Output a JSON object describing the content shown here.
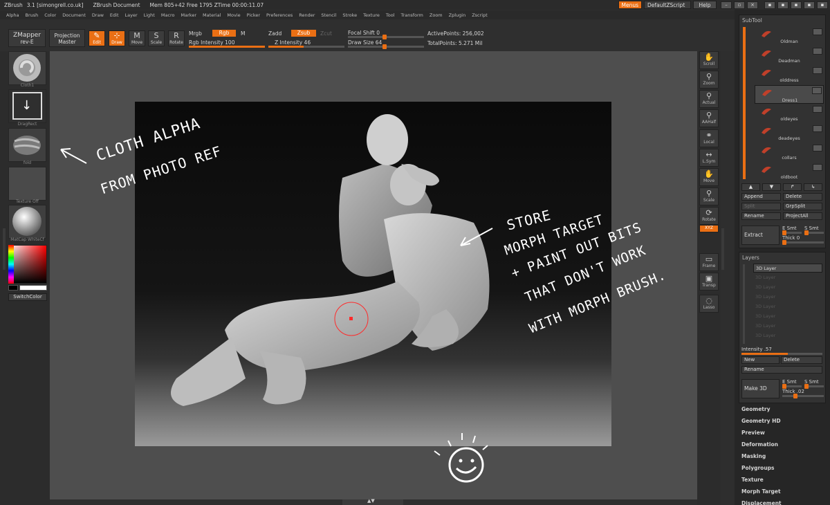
{
  "window": {
    "title_parts": [
      "ZBrush",
      "3.1 [simongrell.co.uk]",
      "ZBrush Document",
      "Mem 805+42 Free 1795 ZTime 00:00:11.07"
    ],
    "buttons": {
      "menus": "Menus",
      "script": "DefaultZScript",
      "help": "Help"
    }
  },
  "menubar": [
    "Alpha",
    "Brush",
    "Color",
    "Document",
    "Draw",
    "Edit",
    "Layer",
    "Light",
    "Macro",
    "Marker",
    "Material",
    "Movie",
    "Picker",
    "Preferences",
    "Render",
    "Stencil",
    "Stroke",
    "Texture",
    "Tool",
    "Transform",
    "Zoom",
    "Zplugin",
    "Zscript"
  ],
  "toolbar": {
    "zmapper_line1": "ZMapper",
    "zmapper_line2": "rev-E",
    "projection_line1": "Projection",
    "projection_line2": "Master",
    "tools": [
      {
        "label": "Edit",
        "glyph": "✎",
        "active": true
      },
      {
        "label": "Draw",
        "glyph": "⊹",
        "active": true
      },
      {
        "label": "Move",
        "glyph": "M",
        "active": false
      },
      {
        "label": "Scale",
        "glyph": "S",
        "active": false
      },
      {
        "label": "Rotate",
        "glyph": "R",
        "active": false
      }
    ],
    "mrgb": "Mrgb",
    "rgb": "Rgb",
    "m": "M",
    "rgb_intensity": "Rgb Intensity 100",
    "rgb_intensity_value": 100,
    "zadd": "Zadd",
    "zsub": "Zsub",
    "zcut": "Zcut",
    "z_intensity": "Z Intensity 46",
    "z_intensity_value": 46,
    "focal_shift": "Focal Shift 0",
    "focal_shift_value": 0,
    "draw_size": "Draw Size 64",
    "draw_size_value": 64,
    "active_points": "ActivePoints: 256,002",
    "total_points": "TotalPoints: 5.271 Mil"
  },
  "left_panel": {
    "thumbs": [
      {
        "caption": "Cloth1",
        "kind": "alpha-swirl"
      },
      {
        "caption": "DragRect",
        "kind": "stroke"
      },
      {
        "caption": "fold",
        "kind": "alpha-fold"
      },
      {
        "caption": "Texture Off",
        "kind": "texture"
      },
      {
        "caption": "MatCap WhiteCf",
        "kind": "material"
      }
    ],
    "switch_color": "SwitchColor"
  },
  "right_strip": [
    {
      "label": "Scroll",
      "icon": "hand-icon",
      "glyph": "✋"
    },
    {
      "label": "Zoom",
      "icon": "zoom-icon",
      "glyph": "⚲"
    },
    {
      "label": "Actual",
      "icon": "actual-icon",
      "glyph": "⚲"
    },
    {
      "label": "AAHalf",
      "icon": "aahalf-icon",
      "glyph": "⚲"
    },
    {
      "label": "Local",
      "icon": "local-icon",
      "glyph": "⚭"
    },
    {
      "label": "L.Sym",
      "icon": "symmetry-icon",
      "glyph": "↔"
    },
    {
      "label": "Move",
      "icon": "move-icon",
      "glyph": "✋"
    },
    {
      "label": "Scale",
      "icon": "scale-icon",
      "glyph": "⚲"
    },
    {
      "label": "Rotate",
      "icon": "rotate-icon",
      "glyph": "⟳"
    },
    {
      "label": "XYZ",
      "icon": "xyz-icon",
      "glyph": ""
    },
    {
      "label": "Frame",
      "icon": "frame-icon",
      "glyph": "▭"
    },
    {
      "label": "Transp",
      "icon": "transp-icon",
      "glyph": "▣"
    },
    {
      "label": "Lasso",
      "icon": "lasso-icon",
      "glyph": "◌"
    }
  ],
  "subtool": {
    "header": "SubTool",
    "items": [
      "Oldman",
      "Deadman",
      "olddress",
      "Dress1",
      "oldeyes",
      "deadeyes",
      "collars",
      "oldboot"
    ],
    "selected": "Dress1",
    "buttons": {
      "append": "Append",
      "delete": "Delete",
      "split": "Split",
      "grpsplit": "GrpSplit",
      "rename": "Rename",
      "projectall": "ProjectAll",
      "extract": "Extract"
    },
    "e_smt": "E Smt",
    "s_smt": "S Smt",
    "thick": "Thick 0",
    "thick_value": 0
  },
  "layers": {
    "header": "Layers",
    "items": [
      "3D Layer",
      "3D Layer",
      "3D Layer",
      "3D Layer",
      "3D Layer",
      "3D Layer",
      "3D Layer",
      "3D Layer"
    ],
    "intensity": "Intensity .57",
    "intensity_value": 0.57,
    "new": "New",
    "delete": "Delete",
    "rename": "Rename",
    "make3d": "Make 3D",
    "e_smt": "E Smt",
    "s_smt": "S Smt",
    "thick": "Thick .02",
    "thick_value": 0.02
  },
  "tool_menu": [
    "Geometry",
    "Geometry HD",
    "Preview",
    "Deformation",
    "Masking",
    "Polygroups",
    "Texture",
    "Morph Target",
    "Displacement"
  ],
  "annotations": {
    "cloth_line1": "CLOTH ALPHA",
    "cloth_line2": "FROM PHOTO REF",
    "store_line1": "STORE",
    "store_line2": "MORPH TARGET",
    "store_line3": "+ PAINT OUT BITS",
    "store_line4": "THAT DON'T WORK",
    "store_line5": "WITH MORPH BRUSH."
  },
  "colors": {
    "accent": "#ea6f14",
    "panel": "#2e2e2e",
    "canvas": "#4e4e4e"
  }
}
